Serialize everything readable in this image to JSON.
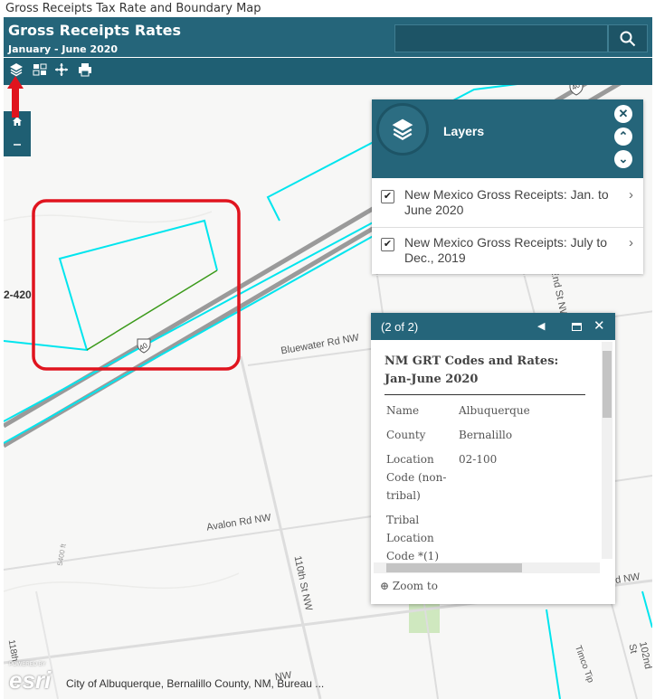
{
  "doc_title": "Gross Receipts Tax Rate and Boundary Map",
  "header": {
    "title": "Gross Receipts Rates",
    "subtitle": "January - June 2020",
    "search_placeholder": ""
  },
  "colors": {
    "header": "#25657a",
    "toolbar": "#1f5f73",
    "boundary": "#00e5ee",
    "highlight_box": "#e0141e",
    "arrow": "#e0141e"
  },
  "map_labels": {
    "partial_road": "2-420",
    "interstate": "40",
    "interstate_top": "40",
    "bluewater": "Bluewater Rd NW",
    "avalon": "Avalon Rd NW",
    "st110": "110th St NW",
    "st102a": "102nd St NW",
    "st102b": "102nd St",
    "rdnw_right": "d NW",
    "contour": "5400 ft",
    "st118": "118th",
    "bottom_nw": "NW",
    "timco": "Timco Tip"
  },
  "layers_panel": {
    "title": "Layers",
    "items": [
      {
        "label": "New Mexico Gross Receipts: Jan. to June 2020",
        "checked": true
      },
      {
        "label": "New Mexico Gross Receipts: July to Dec., 2019",
        "checked": true
      }
    ]
  },
  "popup": {
    "count": "(2 of 2)",
    "title": "NM GRT Codes and Rates: Jan-June 2020",
    "fields": [
      {
        "name": "Name",
        "value": "Albuquerque"
      },
      {
        "name": "County",
        "value": "Bernalillo"
      },
      {
        "name": "Location Code (non-tribal)",
        "value": "02-100"
      },
      {
        "name": "Tribal Location Code *(1)",
        "value": ""
      }
    ],
    "zoom_to": "Zoom to"
  },
  "esri": {
    "powered_by": "POWERED BY",
    "logo": "esri"
  },
  "attribution": "City of Albuquerque, Bernalillo County, NM, Bureau ..."
}
